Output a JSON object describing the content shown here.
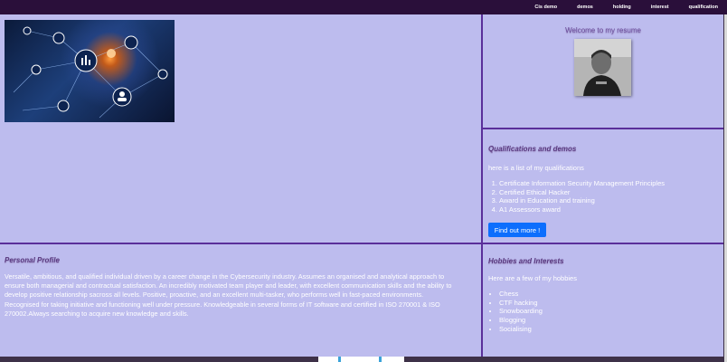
{
  "nav": {
    "items": [
      "Cis demo",
      "demos",
      "holding",
      "interest",
      "qualification"
    ]
  },
  "welcome": {
    "title": "Welcome to my resume"
  },
  "qualifications": {
    "title": "Qualifications and demos",
    "intro": "here is a list of my qualifications",
    "items": [
      "Certificate Information Security Management Principles",
      "Certified Ethical Hacker",
      "Award in Education and training",
      "A1 Assessors award"
    ],
    "button_label": "Find out more !"
  },
  "profile": {
    "title": "Personal Profile",
    "text": "Versatile, ambitious, and qualified individual driven by a career change in the Cybersecurity industry. Assumes an organised and analytical approach to ensure both managerial and contractual satisfaction. An incredibly motivated team player and leader, with excellent communication skills and the ability to develop positive relationship sacross all levels. Positive, proactive, and an excellent multi-tasker, who performs well in fast-paced environments. Recognised for taking initiative and functioning well under pressure. Knowledgeable in several forms of IT software and certified in ISO 270001 & ISO 270002.Always searching to acquire new knowledge and skills."
  },
  "hobbies": {
    "title": "Hobbies and Interests",
    "intro": "Here are a few of my hobbies",
    "items": [
      "Chess",
      "CTF hacking",
      "Snowboarding",
      "Blogging",
      "Socialising"
    ]
  },
  "colors": {
    "nav_bg": "#2a0f3a",
    "panel_bg": "#bdbcee",
    "divider": "#5a2f9a",
    "button": "#0d6efd"
  }
}
